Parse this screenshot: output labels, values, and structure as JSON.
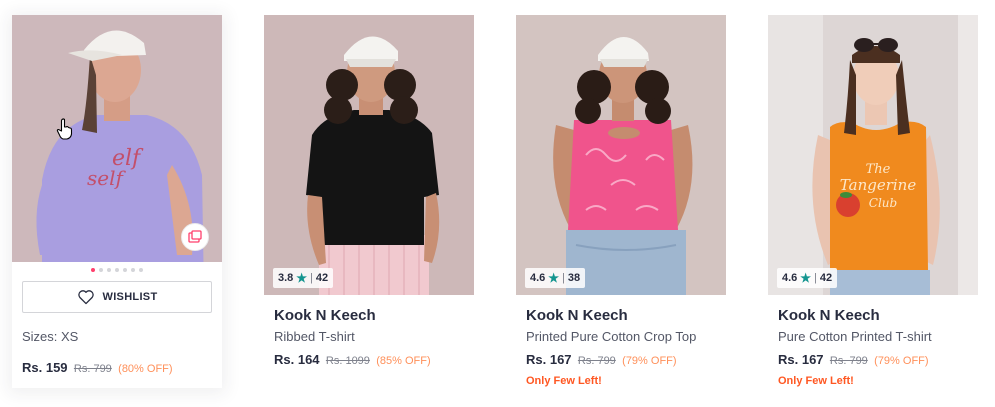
{
  "colors": {
    "accent": "#ff3f6c",
    "discount": "#ff905a",
    "few_left": "#ff5722",
    "rating_star": "#14958f"
  },
  "products": [
    {
      "state": "hover",
      "image_icons": [
        "similar-products-icon"
      ],
      "carousel_dots": 7,
      "carousel_active_index": 0,
      "wishlist_label": "WISHLIST",
      "sizes": "Sizes: XS",
      "price": "Rs. 159",
      "mrp": "Rs. 799",
      "discount": "(80% OFF)"
    },
    {
      "brand": "Kook N Keech",
      "name": "Ribbed T-shirt",
      "rating": "3.8",
      "rating_count": "42",
      "price": "Rs. 164",
      "mrp": "Rs. 1099",
      "discount": "(85% OFF)"
    },
    {
      "brand": "Kook N Keech",
      "name": "Printed Pure Cotton Crop Top",
      "rating": "4.6",
      "rating_count": "38",
      "price": "Rs. 167",
      "mrp": "Rs. 799",
      "discount": "(79% OFF)",
      "stock_note": "Only Few Left!"
    },
    {
      "brand": "Kook N Keech",
      "name": "Pure Cotton Printed T-shirt",
      "rating": "4.6",
      "rating_count": "42",
      "price": "Rs. 167",
      "mrp": "Rs. 799",
      "discount": "(79% OFF)",
      "stock_note": "Only Few Left!"
    }
  ]
}
